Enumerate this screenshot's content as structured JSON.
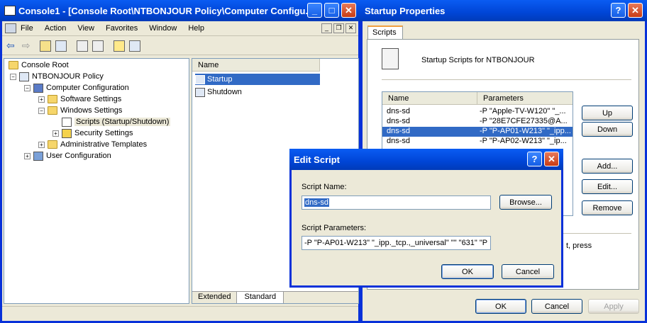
{
  "console": {
    "title": "Console1 - [Console Root\\NTBONJOUR Policy\\Computer Configu...",
    "menu": [
      "File",
      "Action",
      "View",
      "Favorites",
      "Window",
      "Help"
    ],
    "tree": [
      {
        "label": "Console Root",
        "indent": 0
      },
      {
        "label": "NTBONJOUR Policy",
        "indent": 1
      },
      {
        "label": "Computer Configuration",
        "indent": 2
      },
      {
        "label": "Software Settings",
        "indent": 3
      },
      {
        "label": "Windows Settings",
        "indent": 3
      },
      {
        "label": "Scripts (Startup/Shutdown)",
        "indent": 4
      },
      {
        "label": "Security Settings",
        "indent": 4
      },
      {
        "label": "Administrative Templates",
        "indent": 3
      },
      {
        "label": "User Configuration",
        "indent": 2
      }
    ],
    "list_header": "Name",
    "list_items": [
      "Startup",
      "Shutdown"
    ],
    "tabs": [
      "Extended",
      "Standard"
    ]
  },
  "startup": {
    "title": "Startup Properties",
    "tab": "Scripts",
    "heading": "Startup Scripts for NTBONJOUR",
    "columns": [
      "Name",
      "Parameters"
    ],
    "rows": [
      {
        "name": "dns-sd",
        "params": "-P \"Apple-TV-W120\" \"_..."
      },
      {
        "name": "dns-sd",
        "params": "-P \"28E7CFE27335@A..."
      },
      {
        "name": "dns-sd",
        "params": "-P \"P-AP01-W213\" \"_ipp..."
      },
      {
        "name": "dns-sd",
        "params": "-P \"P-AP02-W213\" \"_ip..."
      }
    ],
    "buttons": {
      "up": "Up",
      "down": "Down",
      "add": "Add...",
      "edit": "Edit...",
      "remove": "Remove",
      "ok": "OK",
      "cancel": "Cancel",
      "apply": "Apply"
    },
    "hint": "t, press"
  },
  "edit": {
    "title": "Edit Script",
    "name_label": "Script Name:",
    "name_value": "dns-sd",
    "browse": "Browse...",
    "params_label": "Script Parameters:",
    "params_value": "-P \"P-AP01-W213\" \"_ipp._tcp.,_universal\" \"\" \"631\" \"P",
    "ok": "OK",
    "cancel": "Cancel"
  }
}
